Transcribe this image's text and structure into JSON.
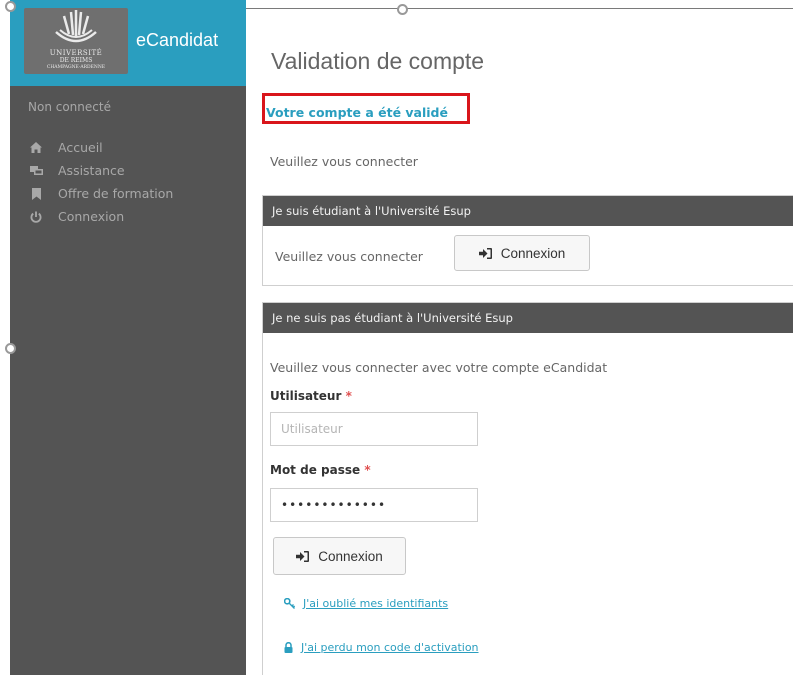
{
  "sidebar": {
    "brand": {
      "logo_line1": "UNIVERSITÉ",
      "logo_line2": "DE REIMS",
      "logo_line3": "CHAMPAGNE-ARDENNE",
      "app_name": "eCandidat"
    },
    "status": "Non connecté",
    "items": [
      {
        "label": "Accueil",
        "icon": "home-icon"
      },
      {
        "label": "Assistance",
        "icon": "assistance-icon"
      },
      {
        "label": "Offre de formation",
        "icon": "bookmark-icon"
      },
      {
        "label": "Connexion",
        "icon": "power-icon"
      }
    ]
  },
  "main": {
    "title": "Validation de compte",
    "success_message": "Votre compte a été validé",
    "prompt": "Veuillez vous connecter",
    "panel_student": {
      "header": "Je suis étudiant à l'Université Esup",
      "text": "Veuillez vous connecter",
      "button": "Connexion"
    },
    "panel_other": {
      "header": "Je ne suis pas étudiant à l'Université Esup",
      "text": "Veuillez vous connecter avec votre compte eCandidat",
      "user_label": "Utilisateur",
      "user_placeholder": "Utilisateur",
      "pass_label": "Mot de passe",
      "pass_value": "•••••••••••••",
      "required_mark": "*",
      "button": "Connexion",
      "link_forgot": "J'ai oublié mes identifiants",
      "link_activation": "J'ai perdu mon code d'activation"
    }
  },
  "colors": {
    "accent": "#2a9ebf",
    "sidebar_bg": "#545454",
    "highlight_border": "#d9151b"
  }
}
